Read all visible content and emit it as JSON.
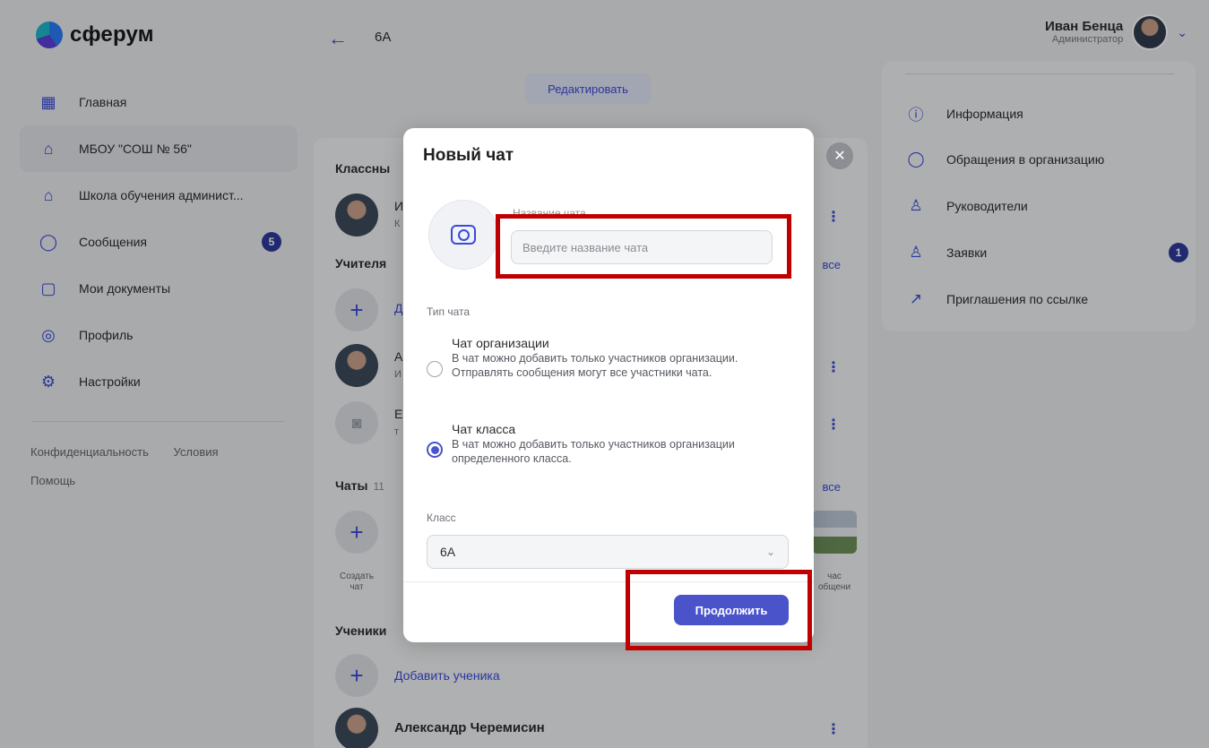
{
  "brand": {
    "name": "сферум"
  },
  "header": {
    "crumb": "6А",
    "user_name": "Иван Бенца",
    "user_role": "Администратор"
  },
  "sidebar": {
    "items": [
      {
        "label": "Главная",
        "icon": "grid-icon"
      },
      {
        "label": "МБОУ \"СОШ № 56\"",
        "icon": "school-icon",
        "active": true
      },
      {
        "label": "Школа обучения админист...",
        "icon": "school-icon"
      },
      {
        "label": "Сообщения",
        "icon": "chat-icon",
        "badge": "5"
      },
      {
        "label": "Мои документы",
        "icon": "document-icon"
      },
      {
        "label": "Профиль",
        "icon": "profile-icon"
      },
      {
        "label": "Настройки",
        "icon": "gear-icon"
      }
    ],
    "footer": [
      "Конфиденциальность",
      "Условия",
      "Помощь"
    ]
  },
  "center": {
    "edit_label": "Редактировать",
    "class_teachers_title": "Классны",
    "teachers_title": "Учителя",
    "chats_title": "Чаты",
    "chats_count": "11",
    "students_title": "Ученики",
    "see_all": "все",
    "row_initial_1": "И",
    "row_sub_1": "К",
    "row_initial_2": "А",
    "row_sub_2": "И",
    "row_initial_3": "Е",
    "row_sub_3": "т",
    "add_initial": "Д",
    "create_chat": "Создать чат",
    "chat_thumb_label": "час общени",
    "add_student": "Добавить ученика",
    "student_name": "Александр Черемисин"
  },
  "right_panel": {
    "items": [
      {
        "label": "Информация",
        "icon": "info-icon"
      },
      {
        "label": "Обращения в организацию",
        "icon": "chat-bubble-icon"
      },
      {
        "label": "Руководители",
        "icon": "person-icon"
      },
      {
        "label": "Заявки",
        "icon": "person-request-icon",
        "badge": "1"
      },
      {
        "label": "Приглашения по ссылке",
        "icon": "link-arrow-icon"
      }
    ]
  },
  "modal": {
    "title": "Новый чат",
    "name_label": "Название чата",
    "name_placeholder": "Введите название чата",
    "name_value": "",
    "type_label": "Тип чата",
    "option_org_title": "Чат организации",
    "option_org_desc": "В чат можно добавить только участников организации. Отправлять сообщения могут все участники чата.",
    "option_class_title": "Чат класса",
    "option_class_desc": "В чат можно добавить только участников организации определенного класса.",
    "selected_type": "Чат класса",
    "class_label": "Класс",
    "class_value": "6А",
    "continue_label": "Продолжить"
  },
  "colors": {
    "accent": "#4a53c9",
    "highlight": "#c00000",
    "badge": "#2e3a9a"
  }
}
